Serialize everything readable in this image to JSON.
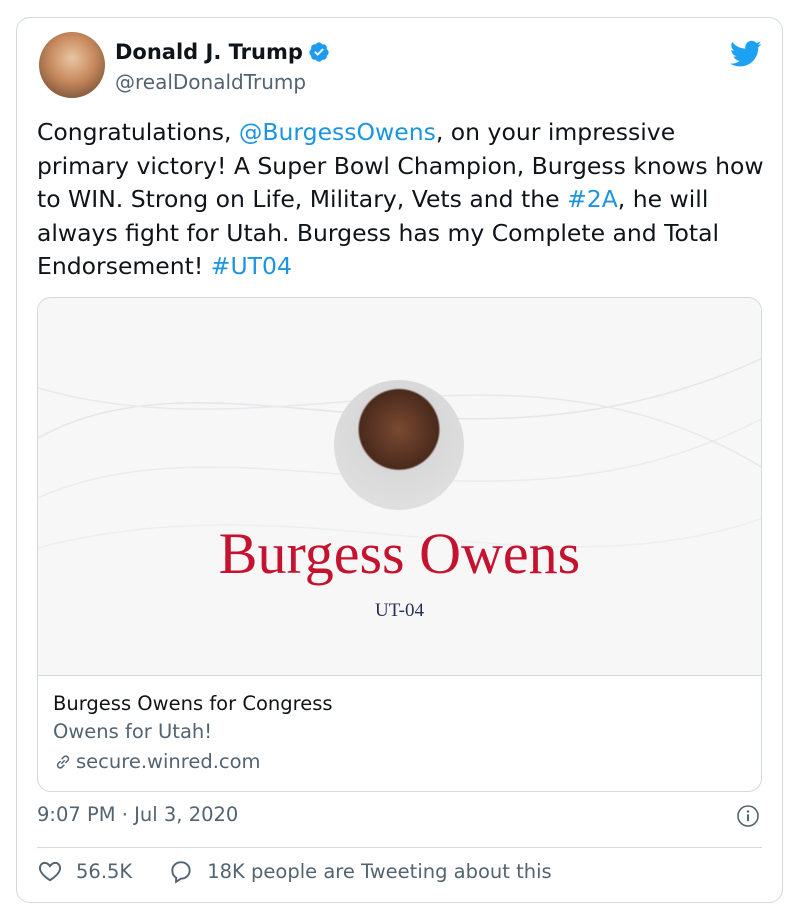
{
  "author": {
    "display_name": "Donald J. Trump",
    "handle": "@realDonaldTrump",
    "verified": true
  },
  "tweet": {
    "segments": [
      {
        "text": "Congratulations, ",
        "type": "plain"
      },
      {
        "text": "@BurgessOwens",
        "type": "link"
      },
      {
        "text": ", on your impressive primary victory! A Super Bowl Champion, Burgess knows how to WIN. Strong on Life, Military, Vets and the ",
        "type": "plain"
      },
      {
        "text": "#2A",
        "type": "link"
      },
      {
        "text": ", he will always fight for Utah. Burgess has my Complete and Total Endorsement! ",
        "type": "plain"
      },
      {
        "text": "#UT04",
        "type": "link"
      }
    ]
  },
  "card": {
    "image_headline": "Burgess Owens",
    "image_subtitle": "UT-04",
    "title": "Burgess Owens for Congress",
    "description": "Owens for Utah!",
    "domain": "secure.winred.com"
  },
  "meta": {
    "timestamp": "9:07 PM · Jul 3, 2020"
  },
  "actions": {
    "likes": "56.5K",
    "conversation": "18K people are Tweeting about this"
  },
  "colors": {
    "link": "#1b95e0",
    "verified": "#1d9bf0",
    "twitter_bird": "#1da1f2",
    "headline_red": "#c4122f"
  },
  "icons": [
    "avatar",
    "verified-badge-icon",
    "twitter-bird-icon",
    "link-icon",
    "info-icon",
    "heart-icon",
    "speech-bubble-icon"
  ]
}
